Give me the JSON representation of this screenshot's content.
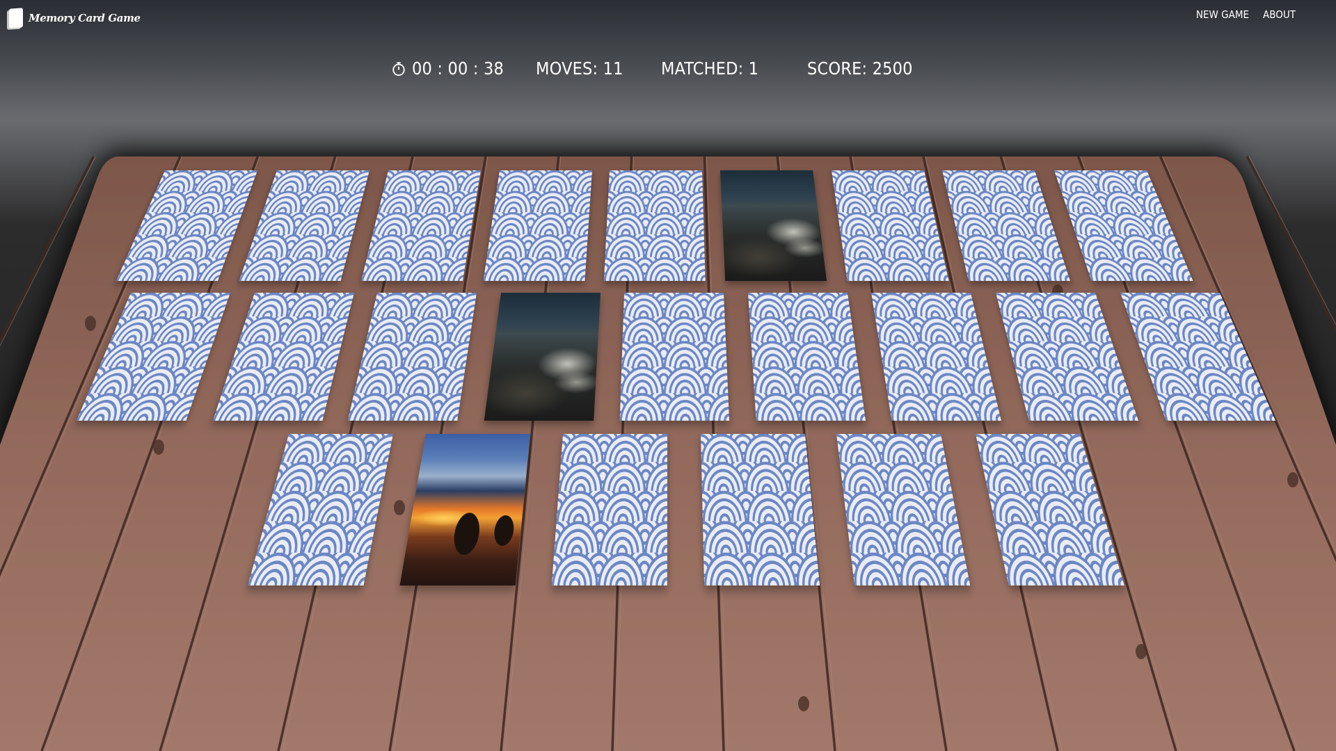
{
  "app": {
    "title": "Memory Card Game",
    "nav": [
      "NEW GAME",
      "ABOUT"
    ]
  },
  "stats": {
    "timer": "00 : 00 : 38",
    "moves": "MOVES: 11",
    "matched": "MATCHED: 1",
    "score": "SCORE: 2500"
  },
  "board": {
    "rows": [
      [
        "back",
        "back",
        "back",
        "back",
        "back",
        "beach-rocks",
        "back",
        "back",
        "back"
      ],
      [
        "back",
        "back",
        "back",
        "beach-rocks",
        "back",
        "back",
        "back",
        "back",
        "back"
      ],
      [
        "back",
        "sunset-rocks",
        "back",
        "back",
        "back",
        "back"
      ]
    ]
  },
  "colors": {
    "card_back_pattern": "#6b86c4",
    "card_back_base": "#e9ecf4",
    "table_wood": "#8e6456"
  },
  "icons": {
    "brand": "card-icon",
    "timer": "stopwatch-icon"
  }
}
